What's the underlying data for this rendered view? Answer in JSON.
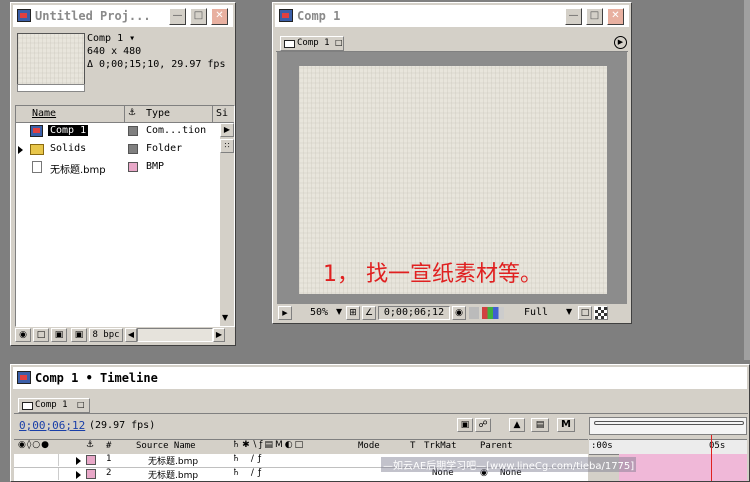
{
  "project": {
    "title": "Untitled Proj...",
    "comp_name": "Comp 1 ▾",
    "dimensions": "640 x 480",
    "duration": "Δ 0;00;15;10, 29.97 fps",
    "col_name": "Name",
    "col_type": "Type",
    "col_size": "Si",
    "items": [
      {
        "name": "Comp 1",
        "type": "Com...tion",
        "color": "#808080"
      },
      {
        "name": "Solids",
        "type": "Folder",
        "color": "#808080"
      },
      {
        "name": "无标题.bmp",
        "type": "BMP",
        "color": "#e8a8c8"
      }
    ],
    "bpc": "8 bpc"
  },
  "comp_window": {
    "title": "Comp 1",
    "tab": "Comp 1",
    "caption": "1， 找一宣纸素材等。",
    "caption_color": "#e02020",
    "zoom": "50%",
    "timecode": "0;00;06;12",
    "resolution": "Full"
  },
  "timeline": {
    "title": "Comp 1 • Timeline",
    "tab": "Comp 1",
    "timecode": "0;00;06;12",
    "fps": "(29.97 fps)",
    "col_num": "#",
    "col_source": "Source Name",
    "col_mode": "Mode",
    "col_t": "T",
    "col_trkmat": "TrkMat",
    "col_parent": "Parent",
    "ruler_start": ":00s",
    "ruler_mid": "05s",
    "layers": [
      {
        "num": "1",
        "name": "无标题.bmp",
        "mode": "",
        "trkmat": "",
        "parent": ""
      },
      {
        "num": "2",
        "name": "无标题.bmp",
        "mode": "",
        "trkmat": "None",
        "parent": "None"
      }
    ],
    "watermark": "—如云AE后期学习吧—[www.lineCg.com/tieba/1775]"
  }
}
